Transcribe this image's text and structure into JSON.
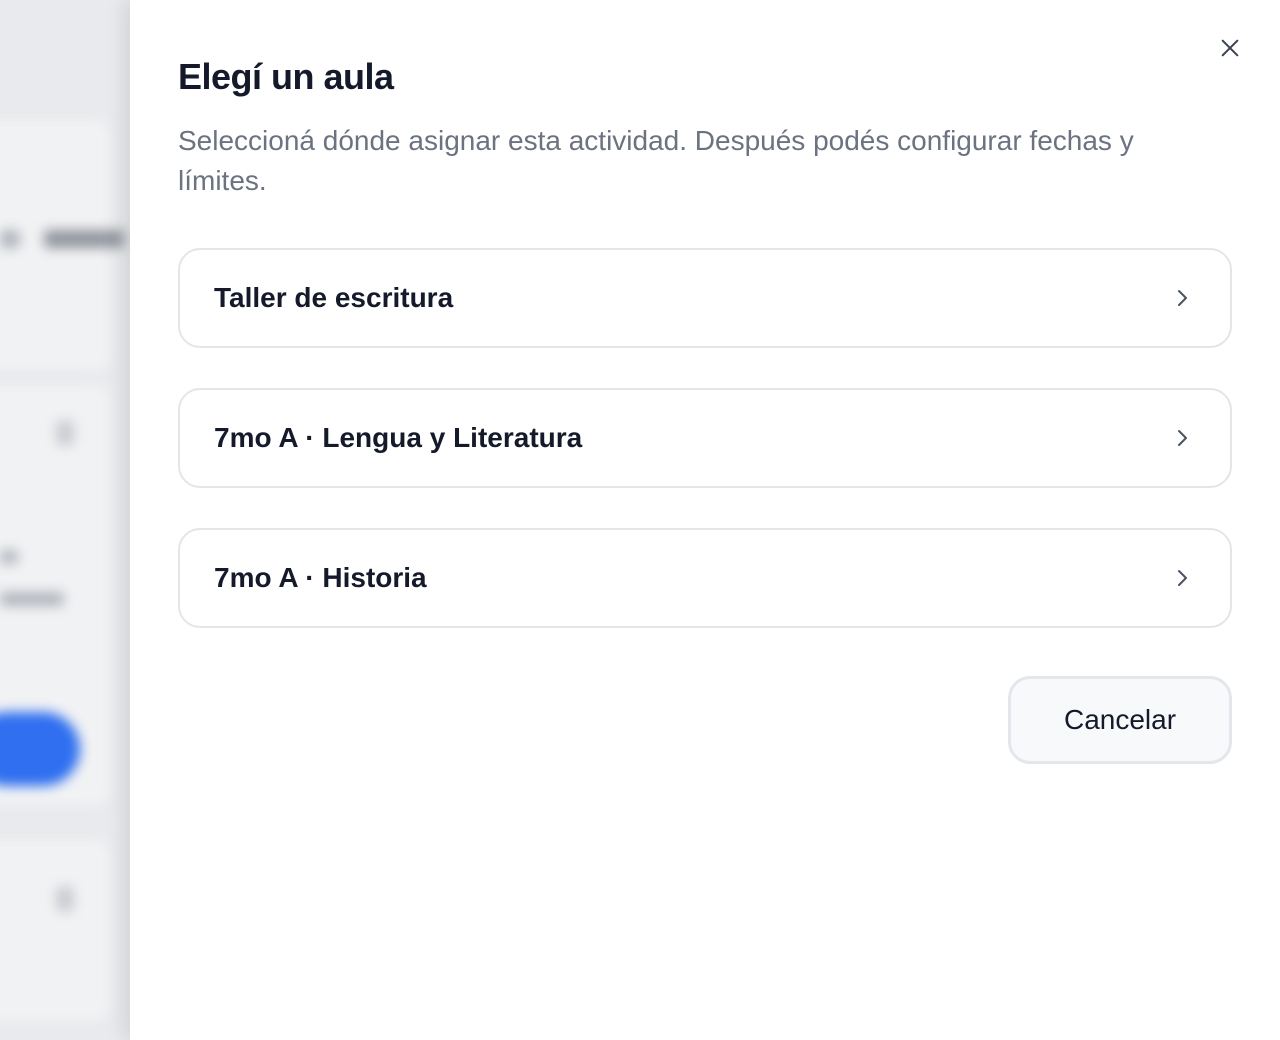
{
  "dialog": {
    "title": "Elegí un aula",
    "description": "Seleccioná dónde asignar esta actividad. Después podés configurar fechas y límites.",
    "close_icon": "close-icon",
    "options": [
      {
        "label": "Taller de escritura",
        "icon": "chevron-right-icon"
      },
      {
        "label": "7mo A · Lengua y Literatura",
        "icon": "chevron-right-icon"
      },
      {
        "label": "7mo A · Historia",
        "icon": "chevron-right-icon"
      }
    ],
    "cancel_label": "Cancelar"
  },
  "colors": {
    "title": "#141a2a",
    "description": "#6b7280",
    "border": "#e3e5e9",
    "backdrop_button": "#2f6ff0"
  }
}
